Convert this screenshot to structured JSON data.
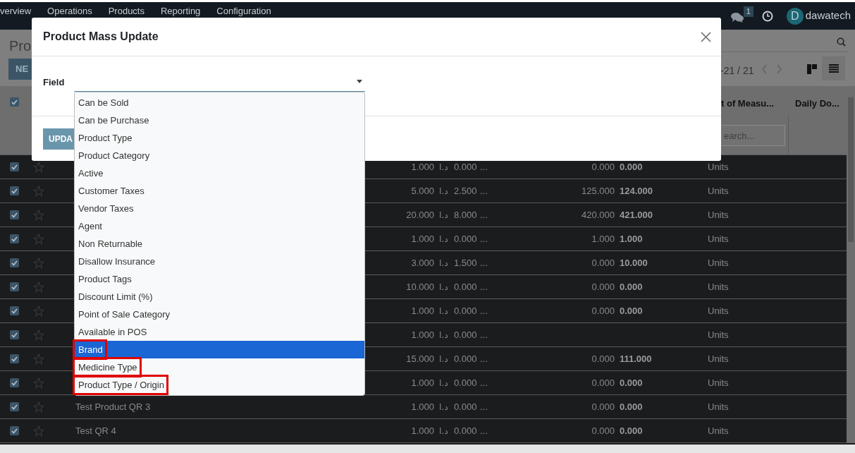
{
  "top_bar": {
    "menu": [
      "verview",
      "Operations",
      "Products",
      "Reporting",
      "Configuration"
    ],
    "messages_badge": "1",
    "avatar_letter": "D",
    "user": "dawatech"
  },
  "control_panel": {
    "title": "Pro",
    "new_button": "NE",
    "pager": "-21 / 21"
  },
  "table": {
    "header_checked": true,
    "columns": [
      "t of Measu...",
      "Daily Do..."
    ],
    "filter_placeholder": "earch...",
    "rows": [
      {
        "checked": true,
        "starred": false,
        "column_1": "1.000",
        "currency": "د.ا",
        "column_2": "0.000",
        "column_3": "...",
        "column_4": "0.000",
        "column_5": "0.000",
        "column_6": "Units"
      },
      {
        "checked": true,
        "starred": false,
        "column_1": "5.000",
        "currency": "د.ا",
        "column_2": "2.500",
        "column_3": "...",
        "column_4": "125.000",
        "column_5": "124.000",
        "column_6": "Units"
      },
      {
        "checked": true,
        "starred": false,
        "column_1": "20.000",
        "currency": "د.ا",
        "column_2": "8.000",
        "column_3": "...",
        "column_4": "420.000",
        "column_5": "421.000",
        "column_6": "Units"
      },
      {
        "checked": true,
        "starred": false,
        "column_1": "1.000",
        "currency": "د.ا",
        "column_2": "0.000",
        "column_3": "...",
        "column_4": "1.000",
        "column_5": "1.000",
        "column_6": "Units"
      },
      {
        "checked": true,
        "starred": false,
        "column_1": "3.000",
        "currency": "د.ا",
        "column_2": "1.500",
        "column_3": "...",
        "column_4": "0.000",
        "column_5": "10.000",
        "column_6": "Units"
      },
      {
        "checked": true,
        "starred": false,
        "column_1": "10.000",
        "currency": "د.ا",
        "column_2": "0.000",
        "column_3": "...",
        "column_4": "0.000",
        "column_5": "0.000",
        "column_6": "Units"
      },
      {
        "checked": true,
        "starred": false,
        "column_1": "1.000",
        "currency": "د.ا",
        "column_2": "0.000",
        "column_3": "...",
        "column_4": "0.000",
        "column_5": "0.000",
        "column_6": "Units"
      },
      {
        "checked": true,
        "starred": false,
        "column_1": "1.000",
        "currency": "د.ا",
        "column_2": "0.000",
        "column_3": "...",
        "column_6": "Units"
      },
      {
        "checked": true,
        "starred": false,
        "column_1": "15.000",
        "currency": "د.ا",
        "column_2": "0.000",
        "column_3": "...",
        "column_4": "0.000",
        "column_5": "111.000",
        "column_6": "Units"
      },
      {
        "checked": true,
        "starred": false,
        "column_1": "1.000",
        "currency": "د.ا",
        "column_2": "0.000",
        "column_3": "...",
        "column_4": "0.000",
        "column_5": "0.000",
        "column_6": "Units"
      },
      {
        "checked": true,
        "starred": false,
        "name": "Test Product QR 3",
        "column_1": "1.000",
        "currency": "د.ا",
        "column_2": "0.000",
        "column_3": "...",
        "column_4": "0.000",
        "column_5": "0.000",
        "column_6": "Units"
      },
      {
        "checked": true,
        "starred": false,
        "name": "Test QR 4",
        "column_1": "1.000",
        "currency": "د.ا",
        "column_2": "0.000",
        "column_3": "...",
        "column_4": "0.000",
        "column_5": "0.000",
        "column_6": "Units"
      }
    ]
  },
  "dialog": {
    "title": "Product Mass Update",
    "field_label": "Field",
    "update_button": "UPDA",
    "options": [
      {
        "label": "Can be Sold",
        "selected": false,
        "highlighted": false
      },
      {
        "label": "Can be Purchase",
        "selected": false,
        "highlighted": false
      },
      {
        "label": "Product Type",
        "selected": false,
        "highlighted": false
      },
      {
        "label": "Product Category",
        "selected": false,
        "highlighted": false
      },
      {
        "label": "Active",
        "selected": false,
        "highlighted": false
      },
      {
        "label": "Customer Taxes",
        "selected": false,
        "highlighted": false
      },
      {
        "label": "Vendor Taxes",
        "selected": false,
        "highlighted": false
      },
      {
        "label": "Agent",
        "selected": false,
        "highlighted": false
      },
      {
        "label": "Non Returnable",
        "selected": false,
        "highlighted": false
      },
      {
        "label": "Disallow Insurance",
        "selected": false,
        "highlighted": false
      },
      {
        "label": "Product Tags",
        "selected": false,
        "highlighted": false
      },
      {
        "label": "Discount Limit (%)",
        "selected": false,
        "highlighted": false
      },
      {
        "label": "Point of Sale Category",
        "selected": false,
        "highlighted": false
      },
      {
        "label": "Available in POS",
        "selected": false,
        "highlighted": false
      },
      {
        "label": "Brand",
        "selected": true,
        "highlighted": true
      },
      {
        "label": "Medicine Type",
        "selected": false,
        "highlighted": true
      },
      {
        "label": "Product Type / Origin",
        "selected": false,
        "highlighted": true
      }
    ]
  }
}
